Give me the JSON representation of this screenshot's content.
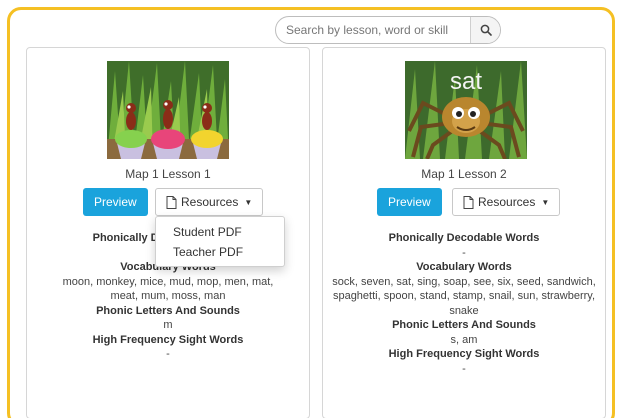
{
  "search": {
    "placeholder": "Search by lesson, word or skill"
  },
  "icons": {
    "search": "magnifier-icon",
    "resources": "document-icon",
    "dropdown": "caret-down-icon"
  },
  "colors": {
    "frame": "#f5c023",
    "preview": "#1aa3dc"
  },
  "lessons": [
    {
      "title": "Map 1 Lesson 1",
      "preview_label": "Preview",
      "resources_label": "Resources",
      "sections": [
        {
          "heading": "Phonically Decodable Words",
          "value": "-"
        },
        {
          "heading": "Vocabulary Words",
          "value": "moon, monkey, mice, mud, mop, men, mat, meat, mum, moss, man"
        },
        {
          "heading": "Phonic Letters And Sounds",
          "value": "m"
        },
        {
          "heading": "High Frequency Sight Words",
          "value": "-"
        }
      ]
    },
    {
      "title": "Map 1 Lesson 2",
      "image_text": "sat",
      "preview_label": "Preview",
      "resources_label": "Resources",
      "sections": [
        {
          "heading": "Phonically Decodable Words",
          "value": "-"
        },
        {
          "heading": "Vocabulary Words",
          "value": "sock, seven, sat, sing, soap, see, six, seed, sandwich, spaghetti, spoon, stand, stamp, snail, sun, strawberry, snake"
        },
        {
          "heading": "Phonic Letters And Sounds",
          "value": "s, am"
        },
        {
          "heading": "High Frequency Sight Words",
          "value": "-"
        }
      ]
    }
  ],
  "dropdown": {
    "items": [
      "Student PDF",
      "Teacher PDF"
    ]
  }
}
